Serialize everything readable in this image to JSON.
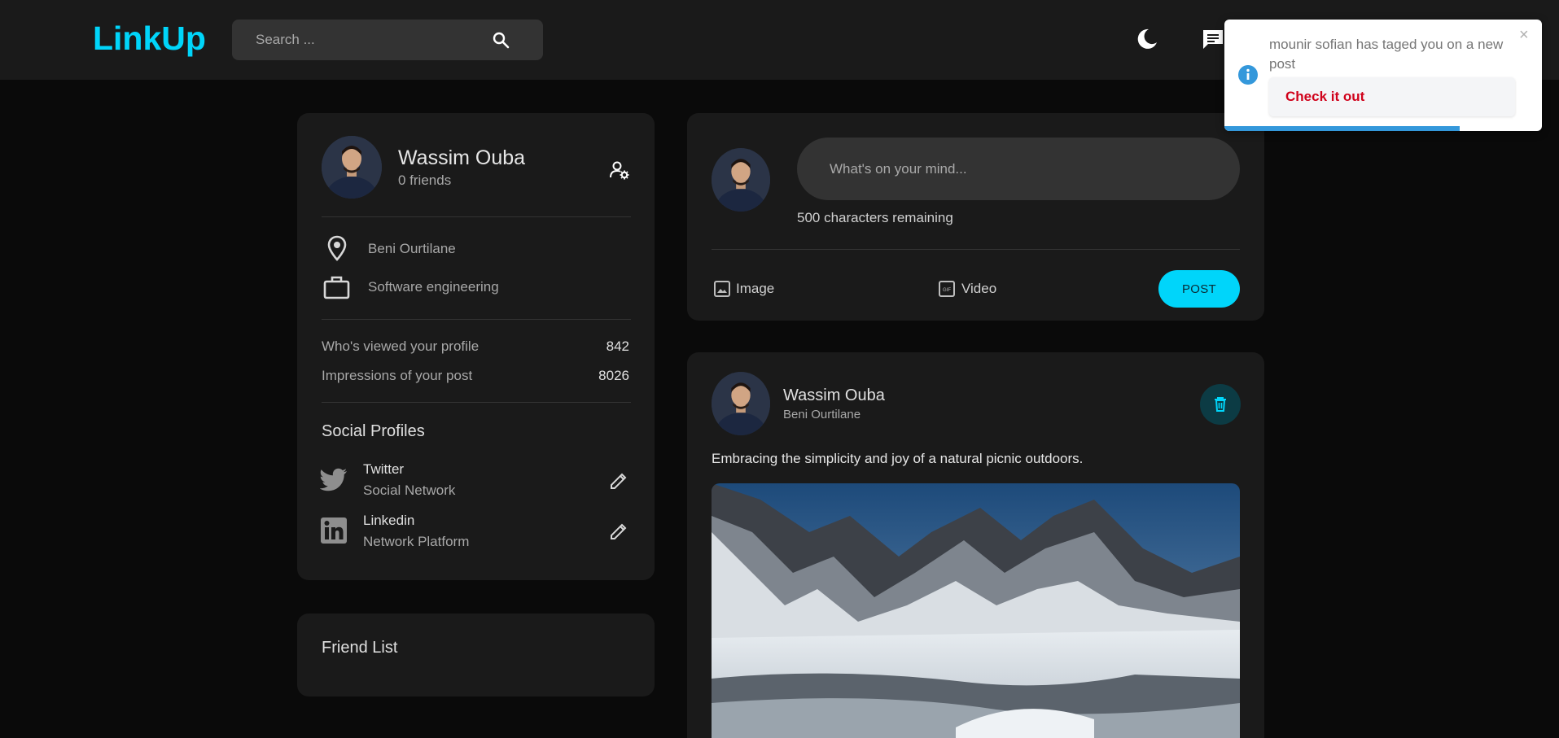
{
  "header": {
    "logo": "LinkUp",
    "search_placeholder": "Search ..."
  },
  "profile": {
    "name": "Wassim Ouba",
    "friends": "0 friends",
    "location": "Beni Ourtilane",
    "occupation": "Software engineering",
    "stats": [
      {
        "label": "Who's viewed your profile",
        "value": "842"
      },
      {
        "label": "Impressions of your post",
        "value": "8026"
      }
    ],
    "social_title": "Social Profiles",
    "socials": [
      {
        "name": "Twitter",
        "type": "Social Network",
        "icon": "twitter-icon"
      },
      {
        "name": "Linkedin",
        "type": "Network Platform",
        "icon": "linkedin-icon"
      }
    ]
  },
  "friend_list": {
    "title": "Friend List"
  },
  "composer": {
    "placeholder": "What's on your mind...",
    "chars_remaining": "500 characters remaining",
    "image_label": "Image",
    "video_label": "Video",
    "post_label": "POST"
  },
  "post": {
    "author": "Wassim Ouba",
    "location": "Beni Ourtilane",
    "text": "Embracing the simplicity and joy of a natural picnic outdoors."
  },
  "toast": {
    "message": "mounir sofian has taged you on a new post",
    "action": "Check it out",
    "close": "×",
    "progress": 0.74
  },
  "colors": {
    "accent": "#00d5fa",
    "background": "#0a0a0a",
    "card": "#1a1a1a",
    "toast_action": "#d0021b",
    "toast_info": "#3498db"
  }
}
